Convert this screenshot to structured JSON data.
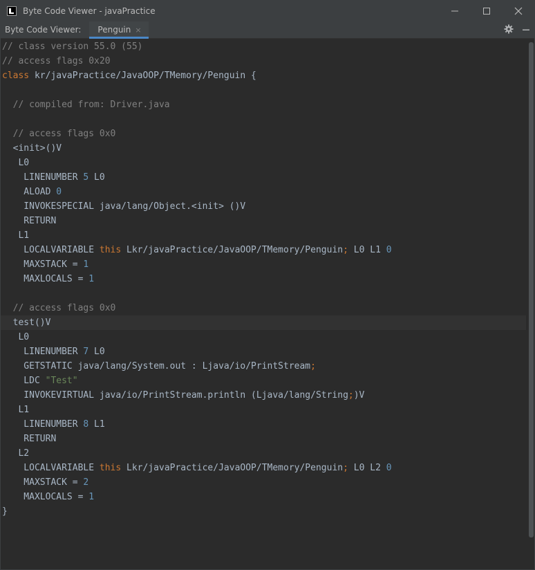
{
  "window": {
    "title": "Byte Code Viewer - javaPractice",
    "logo_icon": "intellij-idea-icon",
    "controls": [
      "minimize-icon",
      "maximize-icon",
      "close-icon"
    ]
  },
  "tabbar": {
    "label": "Byte Code Viewer:",
    "tab_label": "Penguin",
    "tab_close": "×",
    "tools": [
      "gear-icon",
      "hide-minus-icon"
    ]
  },
  "colors": {
    "comment": "#808080",
    "keyword": "#cc7832",
    "number": "#6897bb",
    "string": "#6a8759",
    "plain": "#a9b7c6",
    "accent": "#4a88c7"
  },
  "code": {
    "l1": "// class version 55.0 (55)",
    "l2": "// access flags 0x20",
    "l3_kw": "class",
    "l3_rest": " kr/javaPractice/JavaOOP/TMemory/Penguin {",
    "l5": "  // compiled from: Driver.java",
    "l7": "  // access flags 0x0",
    "l8": "  <init>()V",
    "l9": "   L0",
    "l10_a": "    LINENUMBER ",
    "l10_n": "5",
    "l10_b": " L0",
    "l11_a": "    ALOAD ",
    "l11_n": "0",
    "l12": "    INVOKESPECIAL java/lang/Object.<init> ()V",
    "l13": "    RETURN",
    "l14": "   L1",
    "l15_a": "    LOCALVARIABLE ",
    "l15_kw": "this",
    "l15_b": " Lkr/javaPractice/JavaOOP/TMemory/Penguin",
    "l15_semi": ";",
    "l15_c": " L0 L1 ",
    "l15_n": "0",
    "l16_a": "    MAXSTACK = ",
    "l16_n": "1",
    "l17_a": "    MAXLOCALS = ",
    "l17_n": "1",
    "l19": "  // access flags 0x0",
    "l20": "  test()V",
    "l21": "   L0",
    "l22_a": "    LINENUMBER ",
    "l22_n": "7",
    "l22_b": " L0",
    "l23_a": "    GETSTATIC java/lang/System.out : Ljava/io/PrintStream",
    "l23_semi": ";",
    "l24_a": "    LDC ",
    "l24_s": "\"Test\"",
    "l25_a": "    INVOKEVIRTUAL java/io/PrintStream.println (Ljava/lang/String",
    "l25_semi": ";",
    "l25_b": ")V",
    "l26": "   L1",
    "l27_a": "    LINENUMBER ",
    "l27_n": "8",
    "l27_b": " L1",
    "l28": "    RETURN",
    "l29": "   L2",
    "l30_a": "    LOCALVARIABLE ",
    "l30_kw": "this",
    "l30_b": " Lkr/javaPractice/JavaOOP/TMemory/Penguin",
    "l30_semi": ";",
    "l30_c": " L0 L2 ",
    "l30_n": "0",
    "l31_a": "    MAXSTACK = ",
    "l31_n": "2",
    "l32_a": "    MAXLOCALS = ",
    "l32_n": "1",
    "l33": "}"
  }
}
